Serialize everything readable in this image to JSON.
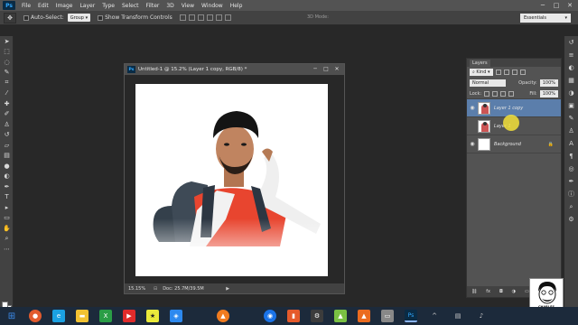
{
  "menubar": {
    "items": [
      "File",
      "Edit",
      "Image",
      "Layer",
      "Type",
      "Select",
      "Filter",
      "3D",
      "View",
      "Window",
      "Help"
    ]
  },
  "options": {
    "auto_select_label": "Auto-Select:",
    "auto_select_value": "Group",
    "transform_label": "Show Transform Controls",
    "mode_3d": "3D Mode:",
    "workspace": "Essentials"
  },
  "document": {
    "title": "Untitled-1 @ 15.2% (Layer 1 copy, RGB/8) *",
    "zoom": "15.15%",
    "doc_info": "Doc: 25.7M/39.5M"
  },
  "layers": {
    "tab": "Layers",
    "kind": "Kind",
    "blend_mode": "Normal",
    "opacity_label": "Opacity:",
    "opacity_value": "100%",
    "lock_label": "Lock:",
    "fill_label": "Fill:",
    "fill_value": "100%",
    "items": [
      {
        "name": "Layer 1 copy",
        "visible": true,
        "active": true
      },
      {
        "name": "Layer 1",
        "visible": false,
        "active": false
      },
      {
        "name": "Background",
        "visible": true,
        "active": false
      }
    ]
  },
  "watermark": {
    "text": "CHARLES CREATION"
  },
  "colors": {
    "accent": "#5b7eab",
    "ui_dark": "#424242",
    "ui_mid": "#535353",
    "taskbar": "#1c2a3b"
  }
}
